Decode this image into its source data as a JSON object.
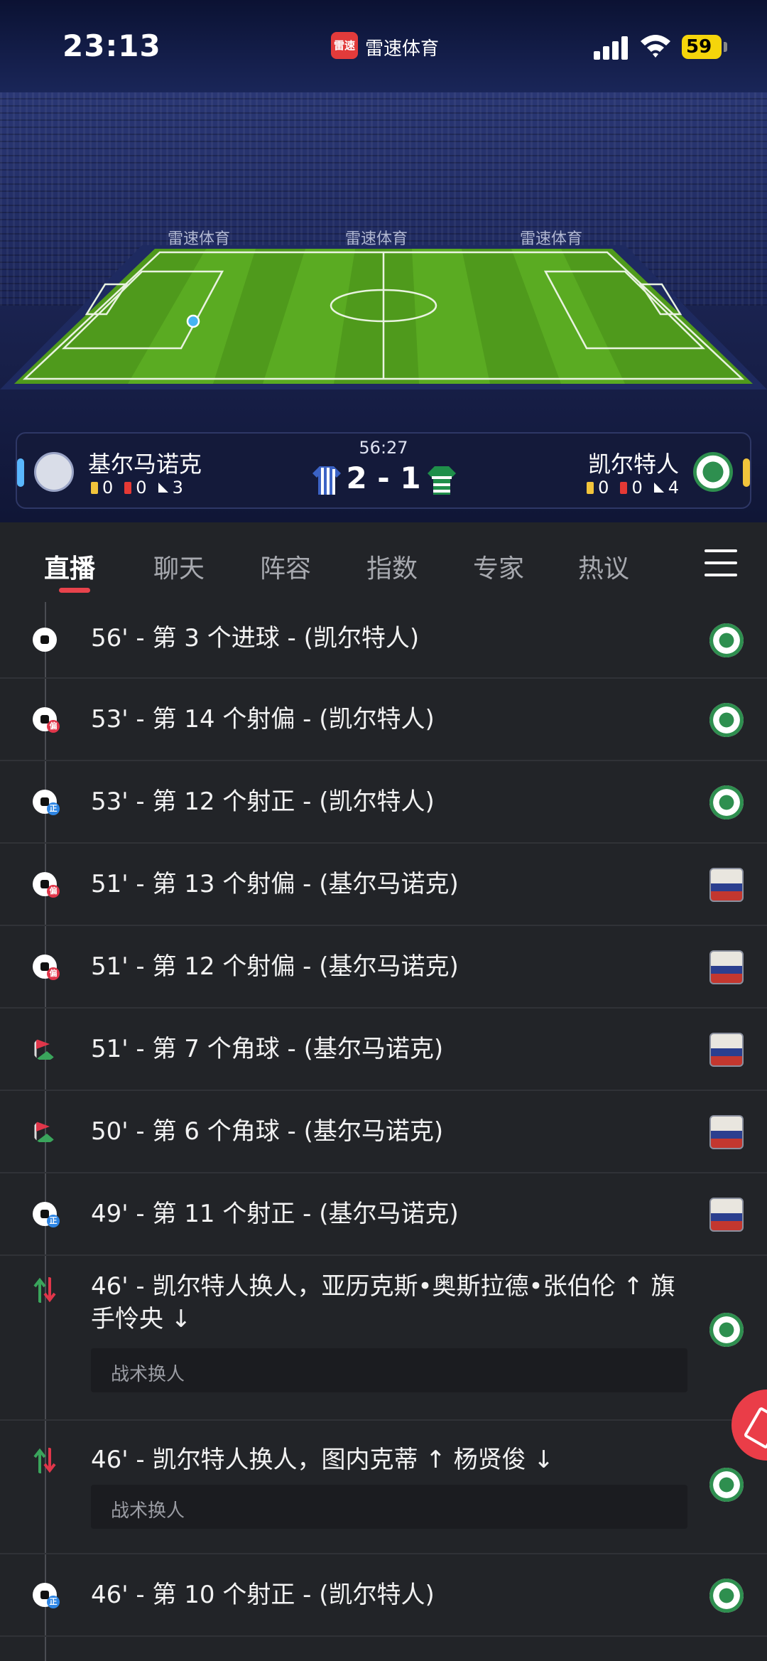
{
  "status_bar": {
    "time": "23:13",
    "app_name": "雷速体育",
    "app_badge": "雷速",
    "battery": "59"
  },
  "stadium": {
    "ad_text": "雷速体育"
  },
  "match": {
    "clock": "56:27",
    "score": "2 - 1",
    "home": {
      "name": "基尔马诺克",
      "yellow": "0",
      "red": "0",
      "corners": "3"
    },
    "away": {
      "name": "凯尔特人",
      "yellow": "0",
      "red": "0",
      "corners": "4"
    }
  },
  "tabs": [
    "直播",
    "聊天",
    "阵容",
    "指数",
    "专家",
    "热议"
  ],
  "events": [
    {
      "text": "56' - 第 3 个进球 - (凯尔特人)",
      "icon": "goal-ball-icon",
      "team": "celtic"
    },
    {
      "text": "53' - 第 14 个射偏 - (凯尔特人)",
      "icon": "shot-off-icon",
      "team": "celtic"
    },
    {
      "text": "53' - 第 12 个射正 - (凯尔特人)",
      "icon": "shot-on-icon",
      "team": "celtic"
    },
    {
      "text": "51' - 第 13 个射偏 - (基尔马诺克)",
      "icon": "shot-off-icon",
      "team": "kilmarnock"
    },
    {
      "text": "51' - 第 12 个射偏 - (基尔马诺克)",
      "icon": "shot-off-icon",
      "team": "kilmarnock"
    },
    {
      "text": "51' - 第 7 个角球 - (基尔马诺克)",
      "icon": "corner-flag-icon",
      "team": "kilmarnock"
    },
    {
      "text": "50' - 第 6 个角球 - (基尔马诺克)",
      "icon": "corner-flag-icon",
      "team": "kilmarnock"
    },
    {
      "text": "49' - 第 11 个射正 - (基尔马诺克)",
      "icon": "shot-on-icon",
      "team": "kilmarnock"
    },
    {
      "text": "46' - 凯尔特人换人，亚历克斯•奥斯拉德•张伯伦 ↑ 旗手怜央 ↓",
      "icon": "substitution-icon",
      "team": "celtic",
      "reason": "战术换人"
    },
    {
      "text": "46' - 凯尔特人换人，图内克蒂 ↑ 杨贤俊 ↓",
      "icon": "substitution-icon",
      "team": "celtic",
      "reason": "战术换人"
    },
    {
      "text": "46' - 第 10 个射正 - (凯尔特人)",
      "icon": "shot-on-icon",
      "team": "celtic"
    }
  ],
  "icon_tags": {
    "off": "偏",
    "on": "正"
  },
  "colors": {
    "accent": "#e8434c",
    "home_side": "#59b7ff",
    "away_side": "#f2c43b",
    "background": "#222428"
  }
}
